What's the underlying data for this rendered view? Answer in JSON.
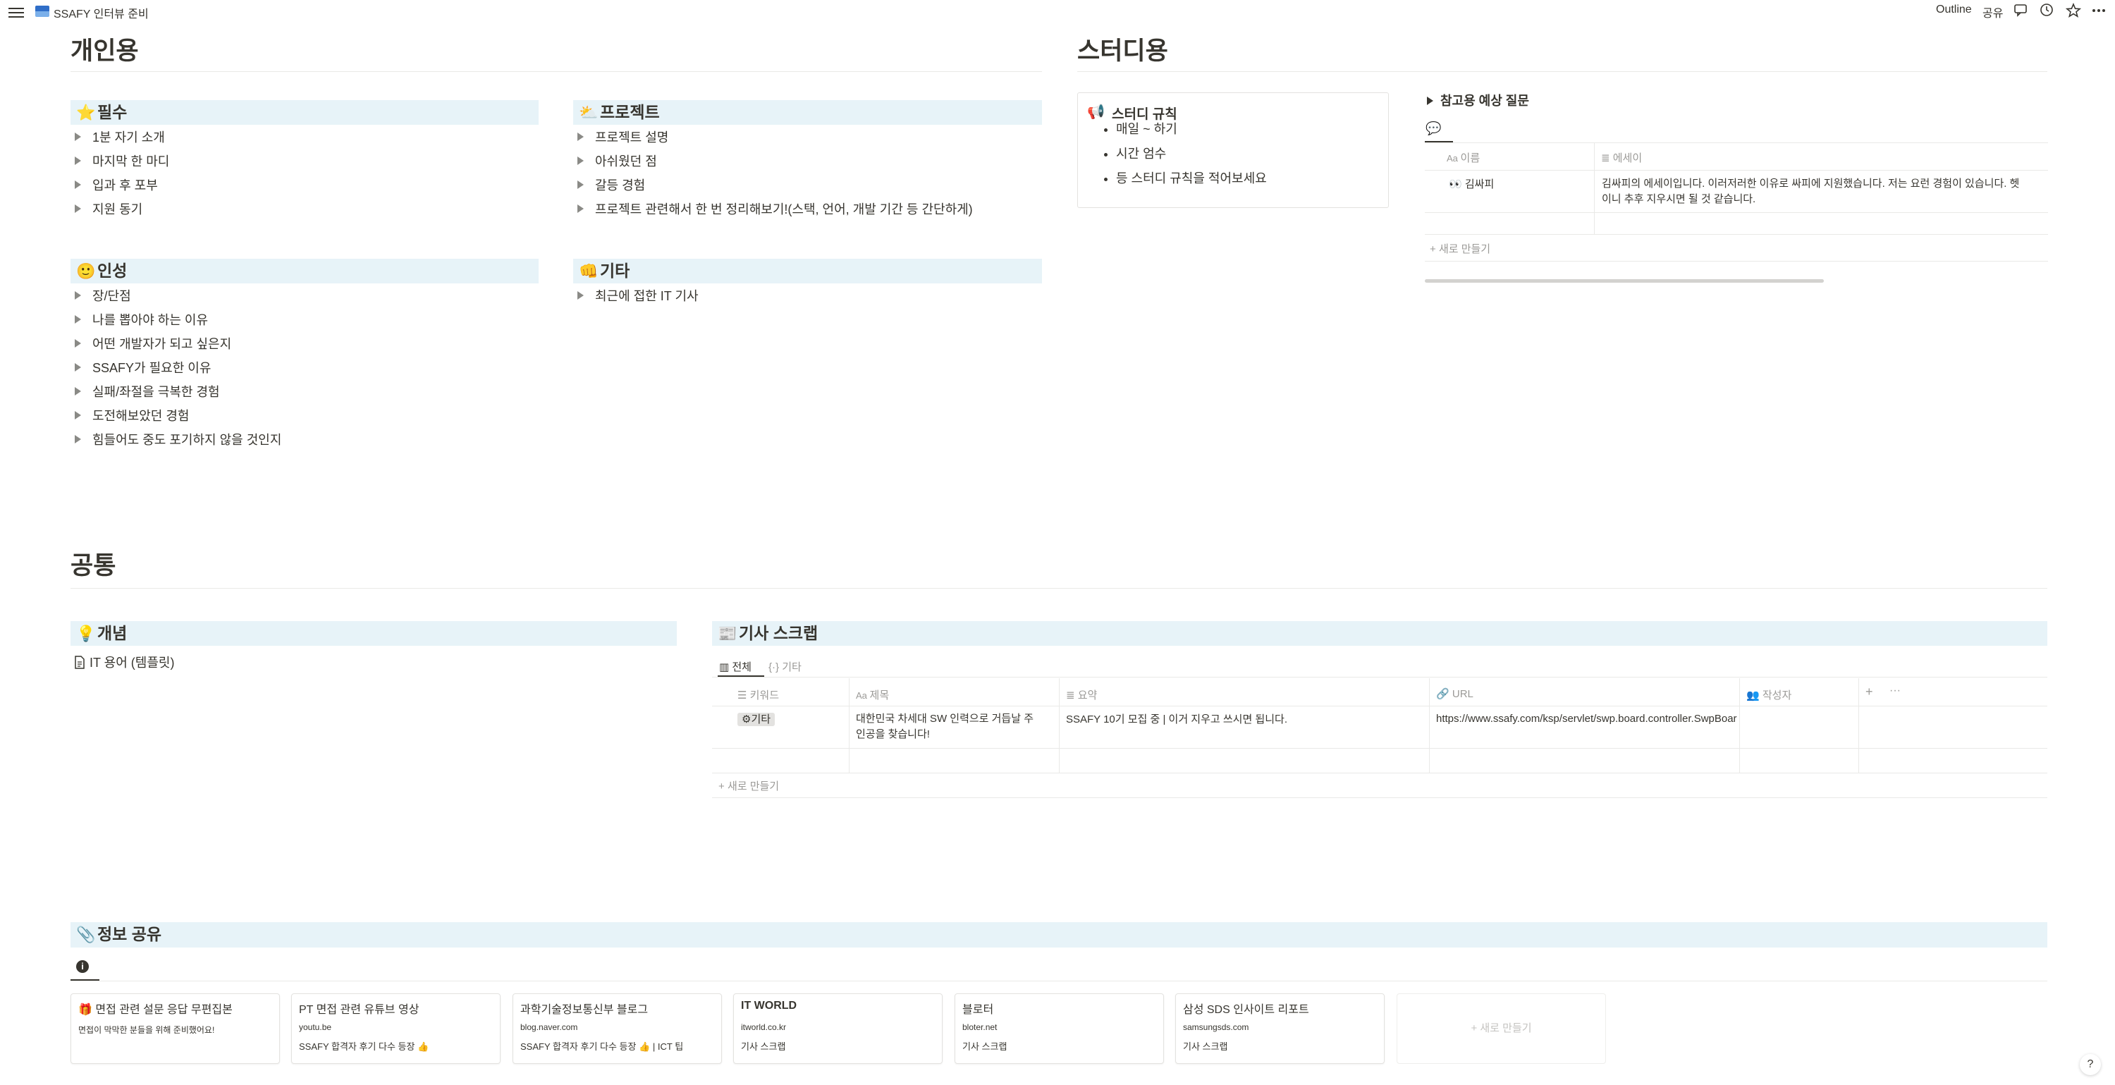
{
  "topbar": {
    "title": "SSAFY 인터뷰 준비",
    "outline": "Outline",
    "share": "공유",
    "icons": [
      "comment-icon",
      "clock-icon",
      "star-icon",
      "more-icon"
    ]
  },
  "personal": {
    "heading": "개인용",
    "must": {
      "icon": "star",
      "title": "필수",
      "items": [
        "1분 자기 소개",
        "마지막 한 마디",
        "입과 후 포부",
        "지원 동기"
      ]
    },
    "project": {
      "icon": "sun-cloud",
      "title": "프로젝트",
      "items": [
        "프로젝트 설명",
        "아쉬웠던 점",
        "갈등 경험",
        "프로젝트 관련해서 한 번 정리해보기!(스택, 언어, 개발 기간 등 간단하게)"
      ]
    },
    "character": {
      "icon": "smile",
      "title": "인성",
      "items": [
        "장/단점",
        "나를 뽑아야 하는 이유",
        "어떤 개발자가 되고 싶은지",
        "SSAFY가 필요한 이유",
        "실패/좌절을 극복한 경험",
        "도전해보았던 경험",
        "힘들어도 중도 포기하지 않을 것인지"
      ]
    },
    "etc": {
      "icon": "fist",
      "title": "기타",
      "items": [
        "최근에 접한 IT 기사"
      ]
    }
  },
  "study": {
    "heading": "스터디용",
    "rules": {
      "icon": "megaphone",
      "title": "스터디 규칙",
      "items": [
        "매일 ~ 하기",
        "시간 엄수",
        "등 스터디 규칙을 적어보세요"
      ]
    },
    "questions_toggle": "참고용 예상 질문",
    "db": {
      "columns": [
        "이름",
        "에세이"
      ],
      "rows": [
        {
          "name": "김싸피",
          "essay": "김싸피의 에세이입니다. 이러저러한 이유로 싸피에 지원했습니다. 저는 요런 경험이 있습니다. 헷",
          "essay2": "이니 추후 지우시면 될 것 같습니다."
        }
      ],
      "new_label": "새로 만들기"
    }
  },
  "common": {
    "heading": "공통",
    "concept": {
      "icon": "bulb",
      "title": "개념",
      "page": "IT 용어 (템플릿)"
    },
    "scrap": {
      "icon": "newspaper",
      "title": "기사 스크랩",
      "tabs": [
        "전체",
        "기타"
      ],
      "columns": [
        "키워드",
        "제목",
        "요약",
        "URL",
        "작성자"
      ],
      "rows": [
        {
          "keyword": "⚙기타",
          "title_l1": "대한민국 차세대 SW 인력으로 거듭날 주",
          "title_l2": "인공을 찾습니다!",
          "summary": "SSAFY 10기 모집 중 | 이거 지우고 쓰시면 됩니다.",
          "url": "https://www.ssafy.com/ksp/servlet/swp.board.controller.SwpBoar",
          "author": ""
        }
      ],
      "new_label": "새로 만들기"
    }
  },
  "share": {
    "icon": "paperclip",
    "title": "정보 공유",
    "cards": [
      {
        "title": "🎁 면접 관련 설문 응답 무편집본",
        "l1": "면접이 막막한 분들을 위해 준비했어요!",
        "l2": ""
      },
      {
        "title": "PT 면접 관련 유튜브 영상",
        "l1": "youtu.be",
        "l2": "SSAFY 합격자 후기 다수 등장 👍"
      },
      {
        "title": "과학기술정보통신부 블로그",
        "l1": "blog.naver.com",
        "l2": "SSAFY 합격자 후기 다수 등장 👍 | ICT 팁"
      },
      {
        "title": "IT WORLD",
        "l1": "itworld.co.kr",
        "l2": "기사 스크랩"
      },
      {
        "title": "블로터",
        "l1": "bloter.net",
        "l2": "기사 스크랩"
      },
      {
        "title": "삼성 SDS 인사이트 리포트",
        "l1": "samsungsds.com",
        "l2": "기사 스크랩"
      }
    ],
    "new_card": "새로 만들기"
  },
  "help": "?"
}
